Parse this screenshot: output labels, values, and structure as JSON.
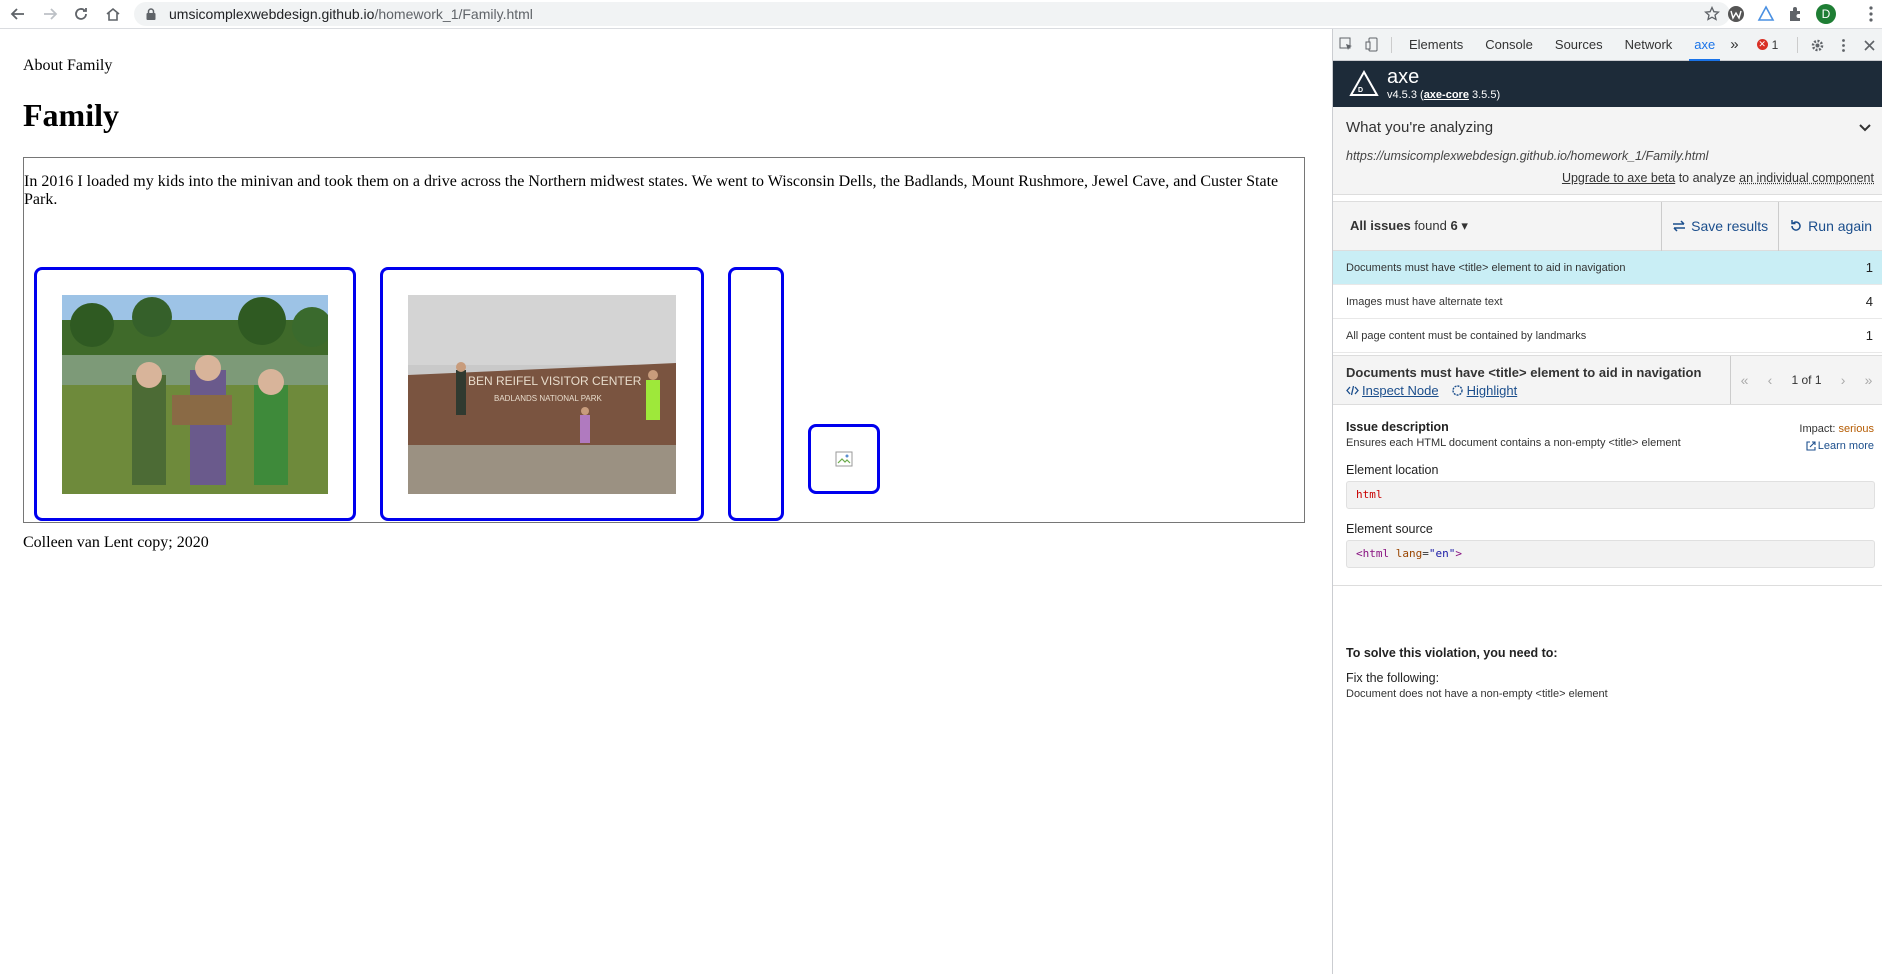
{
  "browser": {
    "url_host": "umsicomplexwebdesign.github.io",
    "url_path": "/homework_1/Family.html",
    "profile_initial": "D"
  },
  "page": {
    "about_link": "About Family",
    "heading": "Family",
    "figure_text": "In 2016 I loaded my kids into the minivan and took them on a drive across the Northern midwest states. We went to Wisconsin Dells, the Badlands, Mount Rushmore, Jewel Cave, and Custer State Park.",
    "sign_line1": "BEN REIFEL VISITOR CENTER",
    "sign_line2": "BADLANDS NATIONAL PARK",
    "footer": "Colleen van Lent copy; 2020"
  },
  "devtools": {
    "tabs": [
      "Elements",
      "Console",
      "Sources",
      "Network",
      "axe"
    ],
    "active_tab": "axe",
    "error_count": "1",
    "more": "»"
  },
  "axe": {
    "title": "axe",
    "version_prefix": "v4.5.3 (",
    "core_label": "axe-core",
    "core_version": " 3.5.5)",
    "analyzing_title": "What you're analyzing",
    "analyzing_url": "https://umsicomplexwebdesign.github.io/homework_1/Family.html",
    "upgrade_link": "Upgrade to axe beta",
    "upgrade_mid": " to analyze ",
    "component_link": "an individual component",
    "issues_label": "All issues",
    "issues_found": " found ",
    "issues_total": "6",
    "save_results": "Save results",
    "run_again": "Run again",
    "issues": [
      {
        "label": "Documents must have <title> element to aid in navigation",
        "count": "1"
      },
      {
        "label": "Images must have alternate text",
        "count": "4"
      },
      {
        "label": "All page content must be contained by landmarks",
        "count": "1"
      }
    ],
    "detail_title": "Documents must have <title> element to aid in navigation",
    "inspect_node": " Inspect Node",
    "highlight": " Highlight",
    "pager": "1 of 1",
    "issue_desc_label": "Issue description",
    "issue_desc": "Ensures each HTML document contains a non-empty <title> element",
    "impact_label": "Impact: ",
    "impact_value": "serious",
    "learn_more": "Learn more",
    "element_location_label": "Element location",
    "element_location": "html",
    "element_source_label": "Element source",
    "source_tag_open": "<html ",
    "source_attr": "lang",
    "source_eq": "=",
    "source_val": "\"en\"",
    "source_close": ">",
    "solve_label": "To solve this violation, you need to:",
    "fix_label": "Fix the following:",
    "fix_text": "Document does not have a non-empty <title> element"
  }
}
